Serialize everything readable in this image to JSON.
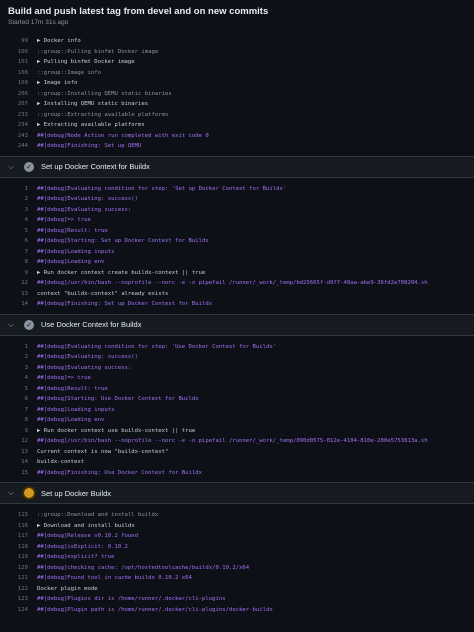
{
  "header": {
    "title": "Build and push latest tag from devel and on new commits",
    "subtitle": "Started 17m 31s ago"
  },
  "colors": {
    "debug": "#a371f7",
    "running": "#d29922",
    "success": "#8b949e"
  },
  "qemu_tail": [
    {
      "n": "99",
      "t": "▶ Docker info",
      "k": "normal"
    },
    {
      "n": "100",
      "t": "::group::Pulling binfmt Docker image",
      "k": "grp"
    },
    {
      "n": "101",
      "t": "▶ Pulling binfmt Docker image",
      "k": "normal"
    },
    {
      "n": "108",
      "t": "::group::Image info",
      "k": "grp"
    },
    {
      "n": "109",
      "t": "▶ Image info",
      "k": "normal"
    },
    {
      "n": "206",
      "t": "::group::Installing QEMU static binaries",
      "k": "grp"
    },
    {
      "n": "207",
      "t": "▶ Installing QEMU static binaries",
      "k": "normal"
    },
    {
      "n": "233",
      "t": "::group::Extracting available platforms",
      "k": "grp"
    },
    {
      "n": "234",
      "t": "▶ Extracting available platforms",
      "k": "normal"
    },
    {
      "n": "243",
      "t": "##[debug]Node Action run completed with exit code 0",
      "k": "dbg"
    },
    {
      "n": "244",
      "t": "##[debug]Finishing: Set up QEMU",
      "k": "dbg"
    }
  ],
  "steps": [
    {
      "label": "Set up Docker Context for Buildx",
      "status": "success",
      "lines": [
        {
          "n": "1",
          "t": "##[debug]Evaluating condition for step: 'Set up Docker Context for Buildx'",
          "k": "dbg"
        },
        {
          "n": "2",
          "t": "##[debug]Evaluating: success()",
          "k": "dbg"
        },
        {
          "n": "3",
          "t": "##[debug]Evaluating success:",
          "k": "dbg"
        },
        {
          "n": "4",
          "t": "##[debug]=> true",
          "k": "dbg"
        },
        {
          "n": "5",
          "t": "##[debug]Result: true",
          "k": "dbg"
        },
        {
          "n": "6",
          "t": "##[debug]Starting: Set up Docker Context for Buildx",
          "k": "dbg"
        },
        {
          "n": "7",
          "t": "##[debug]Loading inputs",
          "k": "dbg"
        },
        {
          "n": "8",
          "t": "##[debug]Loading env",
          "k": "dbg"
        },
        {
          "n": "9",
          "t": "▶ Run docker context create buildx-context || true",
          "k": "normal"
        },
        {
          "n": "12",
          "t": "##[debug]/usr/bin/bash --noprofile --norc -e -o pipefail /runner/_work/_temp/bd25665f-d9f7-48aa-abe9-36fd2e708204.sh",
          "k": "dbg"
        },
        {
          "n": "13",
          "t": "context \"buildx-context\" already exists",
          "k": "normal"
        },
        {
          "n": "14",
          "t": "##[debug]Finishing: Set up Docker Context for Buildx",
          "k": "dbg"
        }
      ]
    },
    {
      "label": "Use Docker Context for Buildx",
      "status": "success",
      "lines": [
        {
          "n": "1",
          "t": "##[debug]Evaluating condition for step: 'Use Docker Context for Buildx'",
          "k": "dbg"
        },
        {
          "n": "2",
          "t": "##[debug]Evaluating: success()",
          "k": "dbg"
        },
        {
          "n": "3",
          "t": "##[debug]Evaluating success:",
          "k": "dbg"
        },
        {
          "n": "4",
          "t": "##[debug]=> true",
          "k": "dbg"
        },
        {
          "n": "5",
          "t": "##[debug]Result: true",
          "k": "dbg"
        },
        {
          "n": "6",
          "t": "##[debug]Starting: Use Docker Context for Buildx",
          "k": "dbg"
        },
        {
          "n": "7",
          "t": "##[debug]Loading inputs",
          "k": "dbg"
        },
        {
          "n": "8",
          "t": "##[debug]Loading env",
          "k": "dbg"
        },
        {
          "n": "9",
          "t": "▶ Run docker context use buildx-context || true",
          "k": "normal"
        },
        {
          "n": "12",
          "t": "##[debug]/usr/bin/bash --noprofile --norc -e -o pipefail /runner/_work/_temp/090d0575-012e-4104-810e-200e5753813a.sh",
          "k": "dbg"
        },
        {
          "n": "13",
          "t": "Current context is now \"buildx-context\"",
          "k": "normal"
        },
        {
          "n": "14",
          "t": "buildx-context",
          "k": "normal"
        },
        {
          "n": "15",
          "t": "##[debug]Finishing: Use Docker Context for Buildx",
          "k": "dbg"
        }
      ]
    },
    {
      "label": "Set up Docker Buildx",
      "status": "running",
      "lines": [
        {
          "n": "115",
          "t": "::group::Download and install buildx",
          "k": "grp"
        },
        {
          "n": "116",
          "t": "▶ Download and install buildx",
          "k": "normal"
        },
        {
          "n": "117",
          "t": "  ##[debug]Release v0.10.2 found",
          "k": "dbg"
        },
        {
          "n": "118",
          "t": "  ##[debug]isExplicit: 0.10.2",
          "k": "dbg"
        },
        {
          "n": "119",
          "t": "  ##[debug]explicit? true",
          "k": "dbg"
        },
        {
          "n": "120",
          "t": "  ##[debug]checking cache: /opt/hostedtoolcache/buildx/0.10.2/x64",
          "k": "dbg"
        },
        {
          "n": "121",
          "t": "  ##[debug]Found tool in cache buildx 0.10.2 x64",
          "k": "dbg"
        },
        {
          "n": "122",
          "t": "  Docker plugin mode",
          "k": "normal"
        },
        {
          "n": "123",
          "t": "  ##[debug]Plugins dir is /home/runner/.docker/cli-plugins",
          "k": "dbg"
        },
        {
          "n": "124",
          "t": "  ##[debug]Plugin path is /home/runner/.docker/cli-plugins/docker-buildx",
          "k": "dbg"
        }
      ]
    }
  ]
}
